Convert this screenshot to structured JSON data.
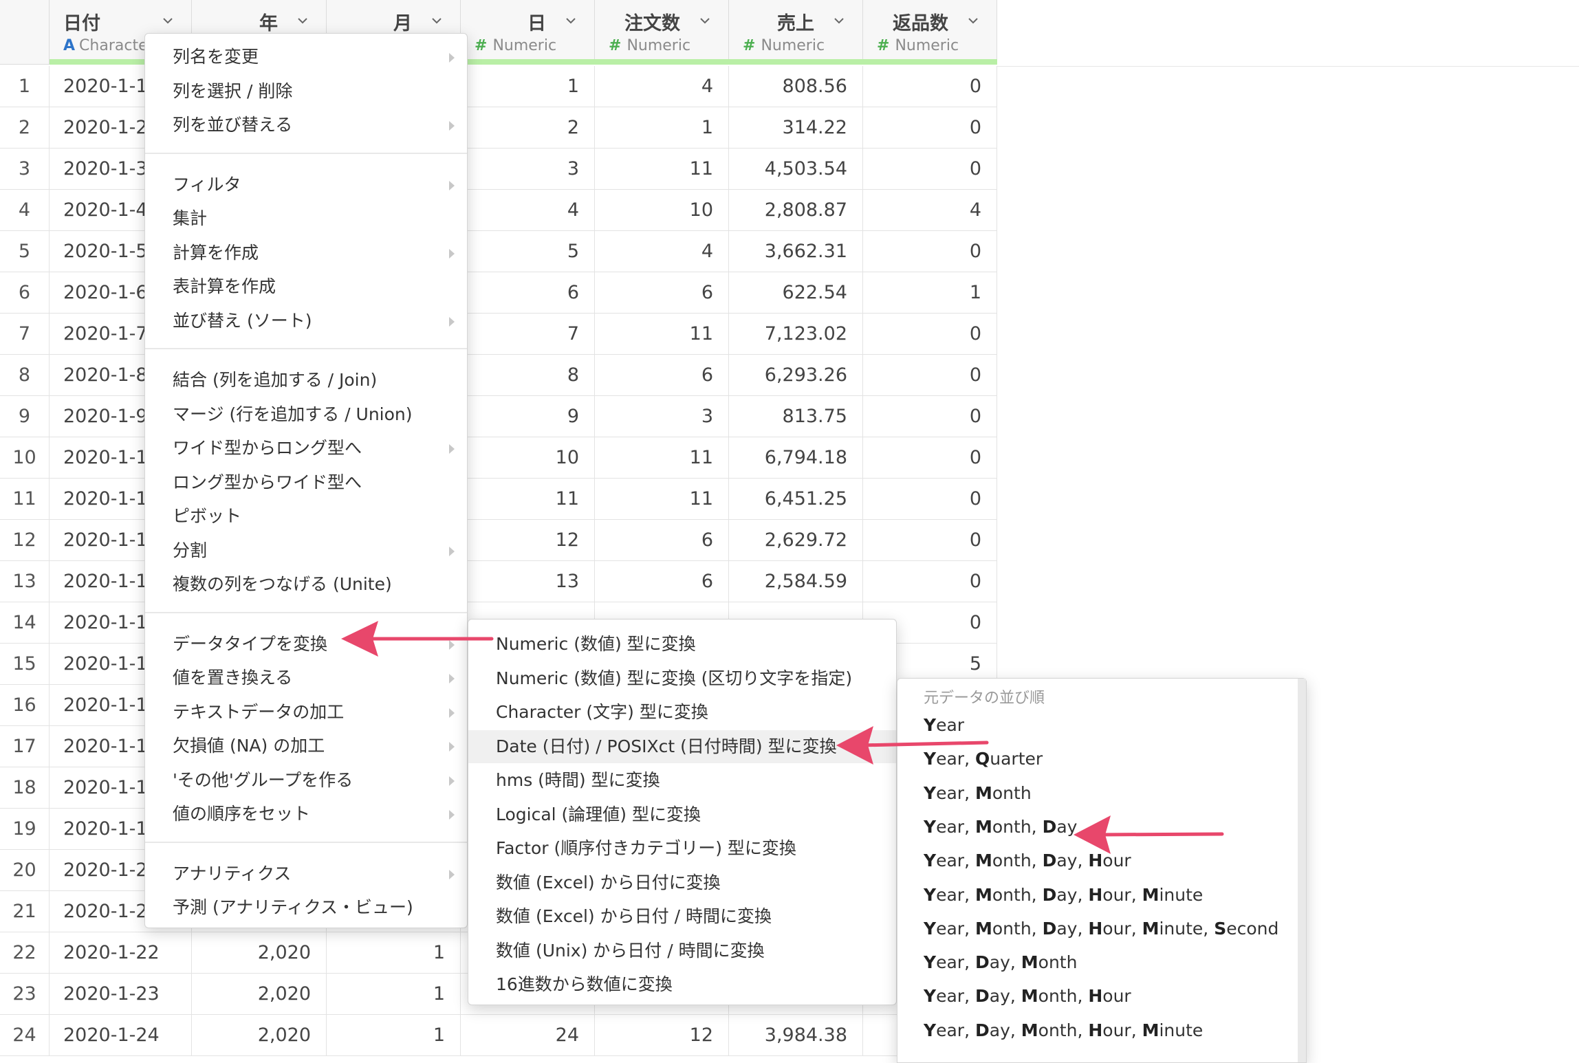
{
  "columns": [
    {
      "name": "日付",
      "type": "Characte",
      "type_symbol": "A"
    },
    {
      "name": "年",
      "type": "",
      "type_symbol": ""
    },
    {
      "name": "月",
      "type": "",
      "type_symbol": ""
    },
    {
      "name": "日",
      "type": "Numeric",
      "type_symbol": "#"
    },
    {
      "name": "注文数",
      "type": "Numeric",
      "type_symbol": "#"
    },
    {
      "name": "売上",
      "type": "Numeric",
      "type_symbol": "#"
    },
    {
      "name": "返品数",
      "type": "Numeric",
      "type_symbol": "#"
    }
  ],
  "rows": [
    {
      "idx": "1",
      "date": "2020-1-1",
      "year": "",
      "month": "",
      "day": "1",
      "orders": "4",
      "sales": "808.56",
      "returns": "0"
    },
    {
      "idx": "2",
      "date": "2020-1-2",
      "year": "",
      "month": "",
      "day": "2",
      "orders": "1",
      "sales": "314.22",
      "returns": "0"
    },
    {
      "idx": "3",
      "date": "2020-1-3",
      "year": "",
      "month": "",
      "day": "3",
      "orders": "11",
      "sales": "4,503.54",
      "returns": "0"
    },
    {
      "idx": "4",
      "date": "2020-1-4",
      "year": "",
      "month": "",
      "day": "4",
      "orders": "10",
      "sales": "2,808.87",
      "returns": "4"
    },
    {
      "idx": "5",
      "date": "2020-1-5",
      "year": "",
      "month": "",
      "day": "5",
      "orders": "4",
      "sales": "3,662.31",
      "returns": "0"
    },
    {
      "idx": "6",
      "date": "2020-1-6",
      "year": "",
      "month": "",
      "day": "6",
      "orders": "6",
      "sales": "622.54",
      "returns": "1"
    },
    {
      "idx": "7",
      "date": "2020-1-7",
      "year": "",
      "month": "",
      "day": "7",
      "orders": "11",
      "sales": "7,123.02",
      "returns": "0"
    },
    {
      "idx": "8",
      "date": "2020-1-8",
      "year": "",
      "month": "",
      "day": "8",
      "orders": "6",
      "sales": "6,293.26",
      "returns": "0"
    },
    {
      "idx": "9",
      "date": "2020-1-9",
      "year": "",
      "month": "",
      "day": "9",
      "orders": "3",
      "sales": "813.75",
      "returns": "0"
    },
    {
      "idx": "10",
      "date": "2020-1-1",
      "year": "",
      "month": "",
      "day": "10",
      "orders": "11",
      "sales": "6,794.18",
      "returns": "0"
    },
    {
      "idx": "11",
      "date": "2020-1-1",
      "year": "",
      "month": "",
      "day": "11",
      "orders": "11",
      "sales": "6,451.25",
      "returns": "0"
    },
    {
      "idx": "12",
      "date": "2020-1-1",
      "year": "",
      "month": "",
      "day": "12",
      "orders": "6",
      "sales": "2,629.72",
      "returns": "0"
    },
    {
      "idx": "13",
      "date": "2020-1-1",
      "year": "",
      "month": "",
      "day": "13",
      "orders": "6",
      "sales": "2,584.59",
      "returns": "0"
    },
    {
      "idx": "14",
      "date": "2020-1-1",
      "year": "",
      "month": "",
      "day": "",
      "orders": "",
      "sales": "",
      "returns": "0"
    },
    {
      "idx": "15",
      "date": "2020-1-1",
      "year": "",
      "month": "",
      "day": "",
      "orders": "",
      "sales": "",
      "returns": "5"
    },
    {
      "idx": "16",
      "date": "2020-1-1",
      "year": "",
      "month": "",
      "day": "",
      "orders": "",
      "sales": "",
      "returns": ""
    },
    {
      "idx": "17",
      "date": "2020-1-1",
      "year": "",
      "month": "",
      "day": "",
      "orders": "",
      "sales": "",
      "returns": ""
    },
    {
      "idx": "18",
      "date": "2020-1-1",
      "year": "",
      "month": "",
      "day": "",
      "orders": "",
      "sales": "",
      "returns": ""
    },
    {
      "idx": "19",
      "date": "2020-1-1",
      "year": "",
      "month": "",
      "day": "",
      "orders": "",
      "sales": "",
      "returns": ""
    },
    {
      "idx": "20",
      "date": "2020-1-2",
      "year": "",
      "month": "",
      "day": "",
      "orders": "",
      "sales": "",
      "returns": ""
    },
    {
      "idx": "21",
      "date": "2020-1-2",
      "year": "",
      "month": "",
      "day": "",
      "orders": "",
      "sales": "",
      "returns": ""
    },
    {
      "idx": "22",
      "date": "2020-1-22",
      "year": "2,020",
      "month": "1",
      "day": "",
      "orders": "",
      "sales": "",
      "returns": ""
    },
    {
      "idx": "23",
      "date": "2020-1-23",
      "year": "2,020",
      "month": "1",
      "day": "",
      "orders": "",
      "sales": "",
      "returns": ""
    },
    {
      "idx": "24",
      "date": "2020-1-24",
      "year": "2,020",
      "month": "1",
      "day": "24",
      "orders": "12",
      "sales": "3,984.38",
      "returns": ""
    }
  ],
  "context_menu": {
    "items": [
      {
        "label": "列名を変更",
        "submenu": true
      },
      {
        "label": "列を選択 / 削除",
        "submenu": false
      },
      {
        "label": "列を並び替える",
        "submenu": true
      },
      {
        "label": "フィルタ",
        "submenu": true
      },
      {
        "label": "集計",
        "submenu": false
      },
      {
        "label": "計算を作成",
        "submenu": true
      },
      {
        "label": "表計算を作成",
        "submenu": false
      },
      {
        "label": "並び替え (ソート)",
        "submenu": true
      },
      {
        "label": "結合 (列を追加する / Join)",
        "submenu": false
      },
      {
        "label": "マージ (行を追加する / Union)",
        "submenu": false
      },
      {
        "label": "ワイド型からロング型へ",
        "submenu": true
      },
      {
        "label": "ロング型からワイド型へ",
        "submenu": false
      },
      {
        "label": "ピボット",
        "submenu": false
      },
      {
        "label": "分割",
        "submenu": true
      },
      {
        "label": "複数の列をつなげる (Unite)",
        "submenu": false
      },
      {
        "label": "データタイプを変換",
        "submenu": true
      },
      {
        "label": "値を置き換える",
        "submenu": true
      },
      {
        "label": "テキストデータの加工",
        "submenu": true
      },
      {
        "label": "欠損値 (NA) の加工",
        "submenu": true
      },
      {
        "label": "'その他'グループを作る",
        "submenu": true
      },
      {
        "label": "値の順序をセット",
        "submenu": true
      },
      {
        "label": "アナリティクス",
        "submenu": true
      },
      {
        "label": "予測 (アナリティクス・ビュー)",
        "submenu": false
      }
    ]
  },
  "convert_menu": {
    "items": [
      "Numeric (数値) 型に変換",
      "Numeric (数値) 型に変換 (区切り文字を指定)",
      "Character (文字) 型に変換",
      "Date (日付) / POSIXct (日付時間) 型に変換",
      "hms (時間) 型に変換",
      "Logical (論理値) 型に変換",
      "Factor (順序付きカテゴリー) 型に変換",
      "数値 (Excel) から日付に変換",
      "数値 (Excel) から日付 / 時間に変換",
      "数値 (Unix) から日付 / 時間に変換",
      "16進数から数値に変換"
    ],
    "highlighted_index": 3
  },
  "date_order_menu": {
    "header": "元データの並び順",
    "items": [
      "Year",
      "Year, Quarter",
      "Year, Month",
      "Year, Month, Day",
      "Year, Month, Day, Hour",
      "Year, Month, Day, Hour, Minute",
      "Year, Month, Day, Hour, Minute, Second",
      "Year, Day, Month",
      "Year, Day, Month, Hour",
      "Year, Day, Month, Hour, Minute"
    ]
  },
  "colors": {
    "arrow": "#e8476b",
    "header_green": "#b9efa6",
    "type_hash": "#4caf50",
    "type_char": "#2d74c9"
  }
}
